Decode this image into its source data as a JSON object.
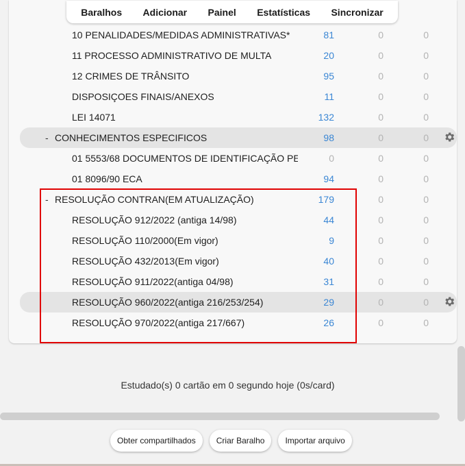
{
  "nav": {
    "items": [
      "Baralhos",
      "Adicionar",
      "Painel",
      "Estatísticas",
      "Sincronizar"
    ]
  },
  "decks": [
    {
      "name": "10 PENALIDADES/MEDIDAS ADMINISTRATIVAS*",
      "new": "81",
      "learn": "0",
      "due": "0",
      "level": 1,
      "collapse": "",
      "highlight": false,
      "gear": false
    },
    {
      "name": "11 PROCESSO ADMINISTRATIVO DE MULTA",
      "new": "20",
      "learn": "0",
      "due": "0",
      "level": 1,
      "collapse": "",
      "highlight": false,
      "gear": false
    },
    {
      "name": "12 CRIMES DE TRÂNSITO",
      "new": "95",
      "learn": "0",
      "due": "0",
      "level": 1,
      "collapse": "",
      "highlight": false,
      "gear": false
    },
    {
      "name": "DISPOSIÇOES FINAIS/ANEXOS",
      "new": "11",
      "learn": "0",
      "due": "0",
      "level": 1,
      "collapse": "",
      "highlight": false,
      "gear": false
    },
    {
      "name": "LEI 14071",
      "new": "132",
      "learn": "0",
      "due": "0",
      "level": 1,
      "collapse": "",
      "highlight": false,
      "gear": false
    },
    {
      "name": "CONHECIMENTOS ESPECIFICOS",
      "new": "98",
      "learn": "0",
      "due": "0",
      "level": 0,
      "collapse": "-",
      "highlight": true,
      "gear": true
    },
    {
      "name": "01 5553/68 DOCUMENTOS DE IDENTIFICAÇÃO PE",
      "new": "0",
      "learn": "0",
      "due": "0",
      "level": 1,
      "collapse": "",
      "highlight": false,
      "gear": false
    },
    {
      "name": "01 8096/90 ECA",
      "new": "94",
      "learn": "0",
      "due": "0",
      "level": 1,
      "collapse": "",
      "highlight": false,
      "gear": false
    },
    {
      "name": "RESOLUÇÃO CONTRAN(EM ATUALIZAÇÃO)",
      "new": "179",
      "learn": "0",
      "due": "0",
      "level": 0,
      "collapse": "-",
      "highlight": false,
      "gear": false
    },
    {
      "name": "RESOLUÇÃO 912/2022 (antiga 14/98)",
      "new": "44",
      "learn": "0",
      "due": "0",
      "level": 1,
      "collapse": "",
      "highlight": false,
      "gear": false
    },
    {
      "name": "RESOLUÇÃO 110/2000(Em vigor)",
      "new": "9",
      "learn": "0",
      "due": "0",
      "level": 1,
      "collapse": "",
      "highlight": false,
      "gear": false
    },
    {
      "name": "RESOLUÇÃO 432/2013(Em vigor)",
      "new": "40",
      "learn": "0",
      "due": "0",
      "level": 1,
      "collapse": "",
      "highlight": false,
      "gear": false
    },
    {
      "name": "RESOLUÇÃO 911/2022(antiga 04/98)",
      "new": "31",
      "learn": "0",
      "due": "0",
      "level": 1,
      "collapse": "",
      "highlight": false,
      "gear": false
    },
    {
      "name": "RESOLUÇÃO 960/2022(antiga 216/253/254)",
      "new": "29",
      "learn": "0",
      "due": "0",
      "level": 1,
      "collapse": "",
      "highlight": true,
      "gear": true
    },
    {
      "name": "RESOLUÇÃO 970/2022(antiga 217/667)",
      "new": "26",
      "learn": "0",
      "due": "0",
      "level": 1,
      "collapse": "",
      "highlight": false,
      "gear": false
    }
  ],
  "studied_text": "Estudado(s) 0 cartão em 0 segundo hoje (0s/card)",
  "buttons": {
    "shared": "Obter compartilhados",
    "create": "Criar Baralho",
    "import": "Importar arquivo"
  },
  "colors": {
    "new_count": "#3a86d4",
    "zero_count": "#b3b3b3",
    "highlight_border": "#e00000"
  },
  "icons": {
    "gear": "gear-icon"
  }
}
